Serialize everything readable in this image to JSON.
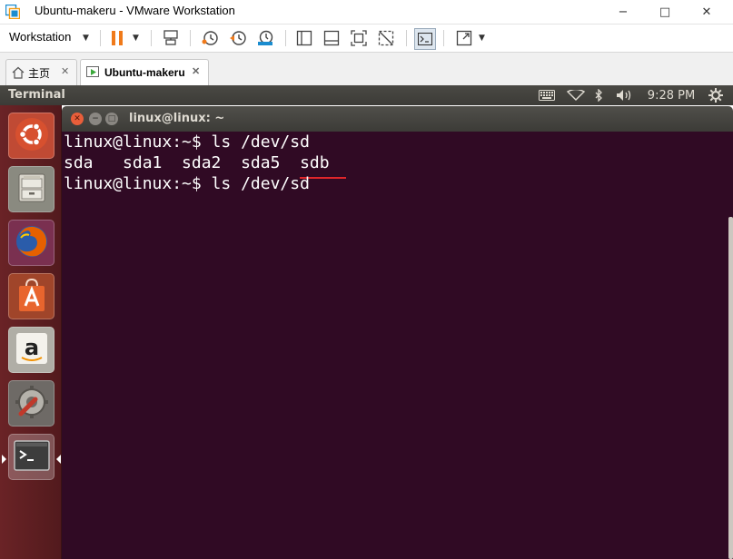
{
  "window": {
    "title": "Ubuntu-makeru - VMware Workstation",
    "minimize": "−",
    "maximize": "□",
    "close": "✕"
  },
  "toolbar": {
    "menu_label": "Workstation"
  },
  "tabs": [
    {
      "label": "主页",
      "icon": "home-icon"
    },
    {
      "label": "Ubuntu-makeru",
      "icon": "vm-running-icon"
    }
  ],
  "ubuntu_panel": {
    "app_title": "Terminal",
    "clock": "9:28 PM"
  },
  "launcher": {
    "items": [
      "dash-home",
      "files",
      "firefox",
      "software-center",
      "amazon",
      "system-settings",
      "terminal"
    ]
  },
  "terminal": {
    "title": "linux@linux: ~",
    "lines": [
      "linux@linux:~$ ls /dev/sd",
      "sda   sda1  sda2  sda5  sdb",
      "linux@linux:~$ ls /dev/sd"
    ]
  },
  "colors": {
    "terminal_bg": "#300a24",
    "launcher_bg": "#5a1d20",
    "annotation": "#e0262a",
    "ubuntu_orange": "#e95420"
  }
}
